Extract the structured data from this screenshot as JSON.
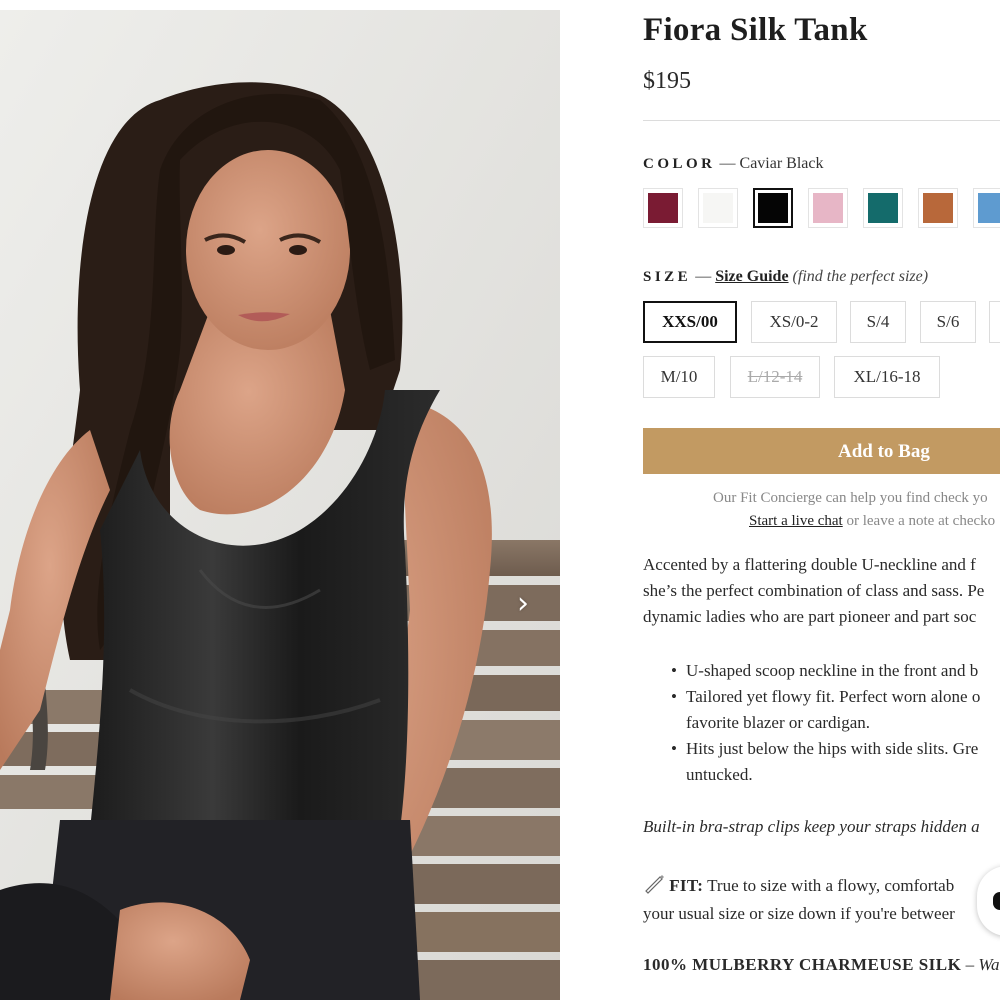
{
  "product": {
    "title": "Fiora Silk Tank",
    "price": "$195"
  },
  "gallery": {
    "next_icon": "chevron-right-icon",
    "next_glyph": "›",
    "image_alt": "Model wearing Fiora Silk Tank seated on a wooden bench"
  },
  "color": {
    "label": "COLOR",
    "separator": "—",
    "selected_name": "Caviar Black",
    "swatches": [
      {
        "hex": "#7a1b33",
        "selected": false
      },
      {
        "hex": "#f6f6f4",
        "selected": false
      },
      {
        "hex": "#050505",
        "selected": true
      },
      {
        "hex": "#e7b6c6",
        "selected": false
      },
      {
        "hex": "#146b6b",
        "selected": false
      },
      {
        "hex": "#b8683a",
        "selected": false
      },
      {
        "hex": "#5e9bd0",
        "selected": false
      }
    ]
  },
  "size": {
    "label": "SIZE",
    "separator": "—",
    "guide_link": "Size Guide",
    "hint": "(find the perfect size)",
    "options": [
      {
        "label": "XXS/00",
        "state": "selected"
      },
      {
        "label": "XS/0-2",
        "state": "available"
      },
      {
        "label": "S/4",
        "state": "available"
      },
      {
        "label": "S/6",
        "state": "available"
      },
      {
        "label": "",
        "state": "available"
      },
      {
        "label": "M/10",
        "state": "available"
      },
      {
        "label": "L/12-14",
        "state": "soldout"
      },
      {
        "label": "XL/16-18",
        "state": "available"
      }
    ]
  },
  "cart": {
    "add_label": "Add to Bag"
  },
  "concierge": {
    "line1": "Our Fit Concierge can help you find check yo",
    "chat_link": "Start a live chat",
    "line2_rest": " or leave a note at checko"
  },
  "description": {
    "lines": [
      "Accented by a flattering double U-neckline and f",
      "she’s the perfect combination of class and sass. Pe",
      "dynamic ladies who are part pioneer and part soc"
    ]
  },
  "features": [
    {
      "lines": [
        "U-shaped scoop neckline in the front and b"
      ]
    },
    {
      "lines": [
        "Tailored yet flowy fit. Perfect worn alone o",
        "favorite blazer or cardigan."
      ]
    },
    {
      "lines": [
        "Hits just below the hips with side slits. Gre",
        "untucked."
      ]
    }
  ],
  "bullet_glyph": "•",
  "note": "Built-in bra-strap clips keep your straps hidden a",
  "fit": {
    "icon": "ruler-pencil-icon",
    "label": "FIT:",
    "line1": " True to size with a flowy, comfortab",
    "line2": "your usual size or size down if you're betweer"
  },
  "material": {
    "label": "100% MULBERRY CHARMEUSE SILK",
    "dash": " – ",
    "rest": "Wa"
  },
  "chat_widget": {
    "icon": "chat-icon"
  }
}
